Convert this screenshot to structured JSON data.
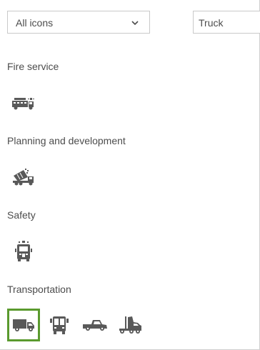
{
  "filter": {
    "selected_value": "All icons",
    "chevron_icon": "chevron-down-icon"
  },
  "search": {
    "value": "Truck"
  },
  "categories": [
    {
      "label": "Fire service",
      "icons": [
        "fire-truck-icon"
      ]
    },
    {
      "label": "Planning and development",
      "icons": [
        "dump-truck-icon"
      ]
    },
    {
      "label": "Safety",
      "icons": [
        "emergency-vehicle-front-icon"
      ]
    },
    {
      "label": "Transportation",
      "icons": [
        "delivery-truck-icon",
        "bus-front-icon",
        "pickup-truck-icon",
        "semi-truck-icon"
      ],
      "selected_icon": "delivery-truck-icon"
    }
  ],
  "colors": {
    "icon": "#595959",
    "selected_border": "#5a9a2e",
    "border": "#c9c9c9",
    "text": "#4c4c4c"
  }
}
